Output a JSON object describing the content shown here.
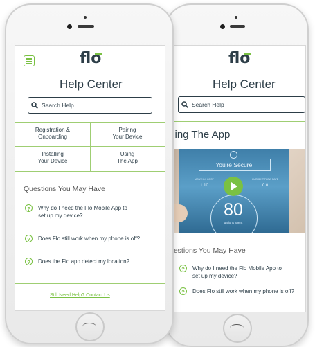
{
  "app": {
    "logo_text": "flo",
    "accent_color": "#7ac143",
    "text_color": "#2d3e48"
  },
  "front": {
    "title": "Help Center",
    "search_placeholder": "Search Help",
    "categories": [
      {
        "line1": "Registration &",
        "line2": "Onboarding"
      },
      {
        "line1": "Pairing",
        "line2": "Your Device"
      },
      {
        "line1": "Installing",
        "line2": "Your Device"
      },
      {
        "line1": "Using",
        "line2": "The App"
      }
    ],
    "questions_heading": "Questions You May Have",
    "questions": [
      {
        "line1": "Why do I need the Flo Mobile App to",
        "line2": "set up my device?"
      },
      {
        "line1": "Does Flo still work when my phone is off?",
        "line2": ""
      },
      {
        "line1": "Does the Flo app detect my location?",
        "line2": ""
      }
    ],
    "footer_link": "Still Need Help? Contact Us"
  },
  "back": {
    "title": "Help Center",
    "search_placeholder": "Search Help",
    "section_title": "sing The App",
    "hero": {
      "status": "You're Secure.",
      "left_label": "MONTHLY COST",
      "left_value": "1.10",
      "right_label": "CURRENT FLOW RATE",
      "right_value": "0.0",
      "big_number": "80",
      "big_unit": "gallons spent"
    },
    "questions_heading": "uestions You May Have",
    "questions": [
      {
        "line1": "Why do I need the Flo Mobile App to",
        "line2": "set up my device?"
      },
      {
        "line1": "Does Flo still work when my phone is off?",
        "line2": ""
      }
    ]
  },
  "icons": {
    "menu": "menu-icon",
    "search": "search-icon",
    "question": "question-icon",
    "play": "play-icon",
    "shield": "shield-icon"
  }
}
